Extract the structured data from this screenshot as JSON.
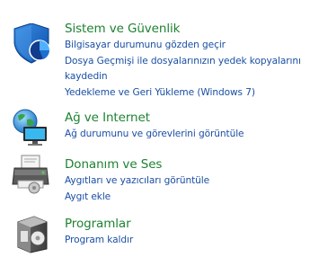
{
  "categories": [
    {
      "title": "Sistem ve Güvenlik",
      "icon": "shield-icon",
      "links": [
        "Bilgisayar durumunu gözden geçir",
        "Dosya Geçmişi ile dosyalarınızın yedek kopyalarını kaydedin",
        "Yedekleme ve Geri Yükleme (Windows 7)"
      ]
    },
    {
      "title": "Ağ ve Internet",
      "icon": "network-globe-icon",
      "links": [
        "Ağ durumunu ve görevlerini görüntüle"
      ]
    },
    {
      "title": "Donanım ve Ses",
      "icon": "printer-icon",
      "links": [
        "Aygıtları ve yazıcıları görüntüle",
        "Aygıt ekle"
      ]
    },
    {
      "title": "Programlar",
      "icon": "programs-box-icon",
      "links": [
        "Program kaldır"
      ]
    }
  ],
  "colors": {
    "title": "#1e8232",
    "link": "#1a4fa3",
    "background": "#ffffff"
  }
}
